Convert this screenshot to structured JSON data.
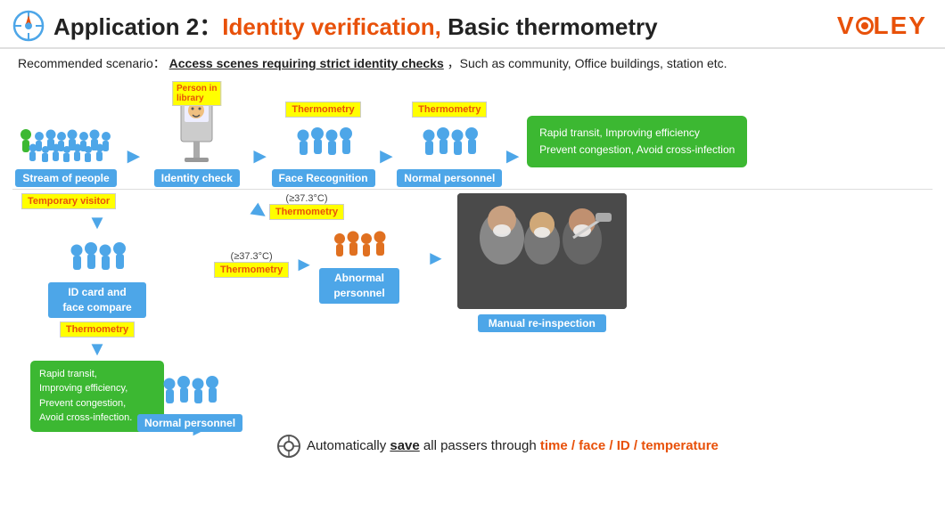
{
  "header": {
    "app_label": "Application 2：",
    "identity_label": "Identity verification,",
    "basic_label": " Basic thermometry",
    "brand": "VLEY"
  },
  "scenario": {
    "prefix": "Recommended scenario：",
    "bold_text": "Access scenes requiring strict identity checks",
    "suffix": "，Such as community, Office buildings, station etc."
  },
  "top_flow": {
    "nodes": [
      {
        "label": "Stream of people"
      },
      {
        "label": "Identity check"
      },
      {
        "label": "Face Recognition"
      },
      {
        "label": "Normal personnel"
      }
    ],
    "person_in_library": "Person in\nlibrary",
    "thermometry_top1": "Thermometry",
    "thermometry_top2": "Thermometry",
    "result_box": "Rapid transit, Improving efficiency\nPrevent congestion, Avoid cross-infection"
  },
  "bottom_flow": {
    "temp_visitor": "Temporary visitor",
    "thermometry_mid": "Thermometry",
    "id_compare_label": "ID card and\nface compare",
    "temp_threshold": "(≥37.3°C)",
    "thermometry_bottom": "Thermometry",
    "abnormal_label": "Abnormal\npersonnel",
    "manual_label": "Manual re-inspection",
    "temp_threshold2": "(≥37.3°C)",
    "result_box2": "Rapid transit,\nImproving efficiency,\nPrevent congestion,\nAvoid cross-infection.",
    "normal_bottom": "Normal personnel"
  },
  "save_line": {
    "text_before": "Automatically ",
    "save_bold": "save",
    "text_mid": " all passers through ",
    "highlights": "time / face / ID / temperature"
  }
}
